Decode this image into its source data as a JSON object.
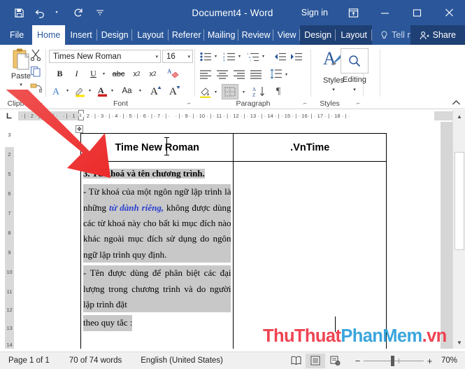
{
  "titlebar": {
    "document_title": "Document4  -  Word",
    "signin": "Sign in",
    "qat": [
      {
        "name": "save-icon",
        "label": "Save"
      },
      {
        "name": "undo-icon",
        "label": "Undo"
      },
      {
        "name": "redo-icon",
        "label": "Redo"
      },
      {
        "name": "customize-qat-icon",
        "label": "Customize Quick Access Toolbar"
      }
    ],
    "window_buttons": [
      {
        "name": "ribbon-display-options-icon",
        "label": "Ribbon Display Options"
      },
      {
        "name": "minimize-icon",
        "label": "Minimize"
      },
      {
        "name": "maximize-icon",
        "label": "Maximize"
      },
      {
        "name": "close-icon",
        "label": "Close"
      }
    ]
  },
  "tabs": [
    {
      "label": "File",
      "active": false
    },
    {
      "label": "Home",
      "active": true
    },
    {
      "label": "Insert",
      "active": false
    },
    {
      "label": "Design",
      "active": false
    },
    {
      "label": "Layout",
      "active": false
    },
    {
      "label": "Referer",
      "active": false
    },
    {
      "label": "Mailing",
      "active": false
    },
    {
      "label": "Review",
      "active": false
    },
    {
      "label": "View",
      "active": false
    },
    {
      "label": "Design",
      "active": false
    },
    {
      "label": "Layout",
      "active": false
    }
  ],
  "tellme": "Tell me",
  "share": "Share",
  "ribbon": {
    "groups": [
      {
        "label": "Clipboard"
      },
      {
        "label": "Font"
      },
      {
        "label": "Paragraph"
      },
      {
        "label": "Styles"
      }
    ],
    "paste_label": "Paste",
    "styles_label": "Styles",
    "editing_label": "Editing",
    "font_name": "Times New Roman",
    "font_size": "16",
    "caret": "▾",
    "collapse_arrow": "^"
  },
  "ruler": {
    "horizontal": "· | · 2 · | · 1 · | · · | · 1 · | · 2 · | · 3 · | · 4 · | · 5 · | · 6 · | · 7 · | · · | · 9 · | · 10 · | · 11 · | · 12 · | · 13 · | · 14 · | · 15 · | · 16· | · 17 · | · 18 · | ·",
    "corner_icon": "L",
    "vertical_labels": [
      "3",
      "2",
      "5",
      "6",
      "7",
      "8",
      "9",
      "10",
      "11",
      "12",
      "13",
      "14"
    ]
  },
  "document": {
    "table": {
      "headers": [
        "Time New Roman",
        ".VnTime"
      ],
      "left_cell": {
        "heading": "3. Từ khoá và tên chương trình.",
        "para1_a": "- Từ khoá của một ngôn ngữ lập trình là những ",
        "para1_kw": "từ dành riêng,",
        "para1_b": " không được dùng các từ khoá này cho bất ki mục đích nào khác ngoài mục đích sử dụng do ngôn ngữ lập trình quy định.",
        "para2": "- Tên được dùng để phân biệt các đại lượng trong chương trình và do người lập trình đặt",
        "para3": "theo quy tắc :"
      },
      "right_cell": ""
    },
    "move_handle_icon": "✥"
  },
  "watermark": {
    "part1": "ThuThuat",
    "part2": "PhanMem",
    "part3": ".vn",
    "color1": "#ef4352",
    "color2": "#3aa5dd"
  },
  "status": {
    "pages": "Page 1 of 1",
    "words": "70 of 74 words",
    "language": "English (United States)",
    "views": [
      {
        "name": "read-mode-icon",
        "label": "Read Mode",
        "selected": false
      },
      {
        "name": "print-layout-icon",
        "label": "Print Layout",
        "selected": true
      },
      {
        "name": "web-layout-icon",
        "label": "Web Layout",
        "selected": false
      }
    ],
    "zoom_out": "−",
    "zoom_in": "+",
    "zoom_level": "70%"
  },
  "colors": {
    "word_blue": "#2b579a",
    "tabtool_blue": "#1e4074",
    "keyword_blue": "#2a3fd0",
    "arrow_red": "#ee3b3b"
  }
}
